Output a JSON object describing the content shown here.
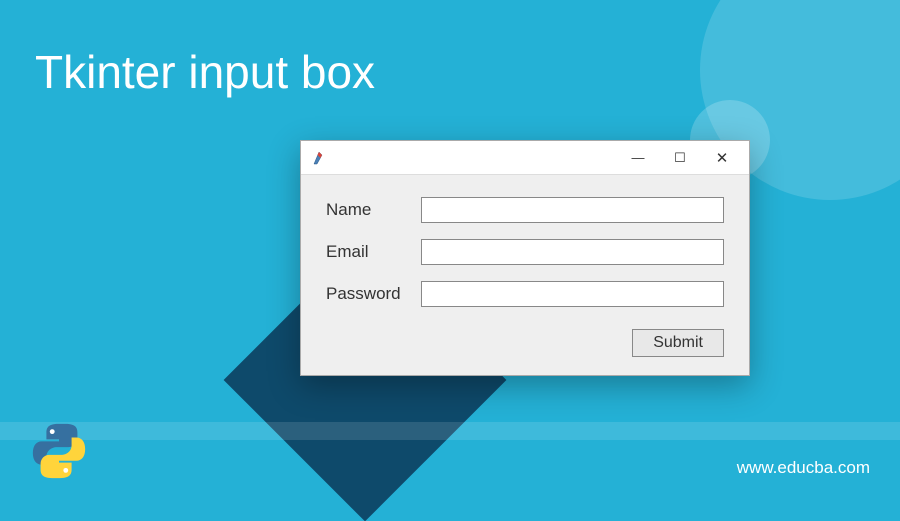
{
  "heading": "Tkinter input box",
  "window": {
    "titlebar": {
      "minimize_glyph": "—",
      "maximize_glyph": "☐",
      "close_glyph": "✕"
    },
    "form": {
      "fields": [
        {
          "label": "Name",
          "value": ""
        },
        {
          "label": "Email",
          "value": ""
        },
        {
          "label": "Password",
          "value": ""
        }
      ],
      "submit_label": "Submit"
    }
  },
  "footer": {
    "url": "www.educba.com"
  }
}
